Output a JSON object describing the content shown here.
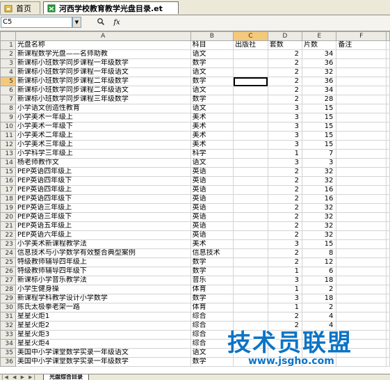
{
  "tabs": {
    "home_label": "首页",
    "file_label": "河西学校教育教学光盘目录.et"
  },
  "formula_bar": {
    "name_box": "C5",
    "search_icon": "magnifier-icon",
    "fx_label": "fx",
    "formula_value": ""
  },
  "columns": [
    "A",
    "B",
    "C",
    "D",
    "E",
    "F"
  ],
  "rows": [
    {
      "n": "1",
      "a": "光盘名称",
      "b": "科目",
      "c": "出版社",
      "d": "套数",
      "e": "片数",
      "f": "备注"
    },
    {
      "n": "2",
      "a": "新课程数学光盘——名师助教",
      "b": "语文",
      "c": "",
      "d": "2",
      "e": "34",
      "f": ""
    },
    {
      "n": "3",
      "a": "新课标小班数学同步课程一年级数学",
      "b": "数学",
      "c": "",
      "d": "2",
      "e": "36",
      "f": ""
    },
    {
      "n": "4",
      "a": "新课标小班数学同步课程一年级语文",
      "b": "语文",
      "c": "",
      "d": "2",
      "e": "32",
      "f": ""
    },
    {
      "n": "5",
      "a": "新课标小班数学同步课程二年级数学",
      "b": "数学",
      "c": "",
      "d": "2",
      "e": "36",
      "f": ""
    },
    {
      "n": "6",
      "a": "新课标小班数学同步课程二年级语文",
      "b": "语文",
      "c": "",
      "d": "2",
      "e": "34",
      "f": ""
    },
    {
      "n": "7",
      "a": "新课标小班数学同步课程三年级数学",
      "b": "数学",
      "c": "",
      "d": "2",
      "e": "28",
      "f": ""
    },
    {
      "n": "8",
      "a": "小学语文创造性教育",
      "b": "语文",
      "c": "",
      "d": "3",
      "e": "15",
      "f": ""
    },
    {
      "n": "9",
      "a": "小学美术一年级上",
      "b": "美术",
      "c": "",
      "d": "3",
      "e": "15",
      "f": ""
    },
    {
      "n": "10",
      "a": "小学美术一年级下",
      "b": "美术",
      "c": "",
      "d": "3",
      "e": "15",
      "f": ""
    },
    {
      "n": "11",
      "a": "小学美术二年级上",
      "b": "美术",
      "c": "",
      "d": "3",
      "e": "15",
      "f": ""
    },
    {
      "n": "12",
      "a": "小学美术三年级上",
      "b": "美术",
      "c": "",
      "d": "3",
      "e": "15",
      "f": ""
    },
    {
      "n": "13",
      "a": "小学科学三年级上",
      "b": "科学",
      "c": "",
      "d": "1",
      "e": "7",
      "f": ""
    },
    {
      "n": "14",
      "a": "杨老师教作文",
      "b": "语文",
      "c": "",
      "d": "3",
      "e": "3",
      "f": ""
    },
    {
      "n": "15",
      "a": "PEP英语四年级上",
      "b": "英语",
      "c": "",
      "d": "2",
      "e": "32",
      "f": ""
    },
    {
      "n": "16",
      "a": "PEP英语四年级下",
      "b": "英语",
      "c": "",
      "d": "2",
      "e": "32",
      "f": ""
    },
    {
      "n": "17",
      "a": "PEP英语四年级上",
      "b": "英语",
      "c": "",
      "d": "2",
      "e": "16",
      "f": ""
    },
    {
      "n": "18",
      "a": "PEP英语四年级下",
      "b": "英语",
      "c": "",
      "d": "2",
      "e": "16",
      "f": ""
    },
    {
      "n": "19",
      "a": "PEP英语三年级上",
      "b": "英语",
      "c": "",
      "d": "2",
      "e": "32",
      "f": ""
    },
    {
      "n": "20",
      "a": "PEP英语三年级下",
      "b": "英语",
      "c": "",
      "d": "2",
      "e": "32",
      "f": ""
    },
    {
      "n": "21",
      "a": "PEP英语五年级上",
      "b": "英语",
      "c": "",
      "d": "2",
      "e": "32",
      "f": ""
    },
    {
      "n": "22",
      "a": "PEP英语六年级上",
      "b": "英语",
      "c": "",
      "d": "2",
      "e": "32",
      "f": ""
    },
    {
      "n": "23",
      "a": "小学美术新课程教学法",
      "b": "美术",
      "c": "",
      "d": "3",
      "e": "15",
      "f": ""
    },
    {
      "n": "24",
      "a": "信息技术与小学数学有效整合典型案例",
      "b": "信息技术",
      "c": "",
      "d": "2",
      "e": "8",
      "f": ""
    },
    {
      "n": "25",
      "a": "特级教师辅导四年级上",
      "b": "数学",
      "c": "",
      "d": "2",
      "e": "12",
      "f": ""
    },
    {
      "n": "26",
      "a": "特级教师辅导四年级下",
      "b": "数学",
      "c": "",
      "d": "1",
      "e": "6",
      "f": ""
    },
    {
      "n": "27",
      "a": "新课标小学音乐教学法",
      "b": "音乐",
      "c": "",
      "d": "3",
      "e": "18",
      "f": ""
    },
    {
      "n": "28",
      "a": "小学生健身操",
      "b": "体育",
      "c": "",
      "d": "1",
      "e": "2",
      "f": ""
    },
    {
      "n": "29",
      "a": "新课程学科教学设计小学数学",
      "b": "数学",
      "c": "",
      "d": "3",
      "e": "18",
      "f": ""
    },
    {
      "n": "30",
      "a": "陈氏太极拳老架一路",
      "b": "体育",
      "c": "",
      "d": "1",
      "e": "2",
      "f": ""
    },
    {
      "n": "31",
      "a": "星星火炬1",
      "b": "综合",
      "c": "",
      "d": "2",
      "e": "4",
      "f": ""
    },
    {
      "n": "32",
      "a": "星星火炬2",
      "b": "综合",
      "c": "",
      "d": "2",
      "e": "4",
      "f": ""
    },
    {
      "n": "33",
      "a": "星星火炬3",
      "b": "综合",
      "c": "",
      "d": "",
      "e": "",
      "f": ""
    },
    {
      "n": "34",
      "a": "星星火炬4",
      "b": "综合",
      "c": "",
      "d": "",
      "e": "",
      "f": ""
    },
    {
      "n": "35",
      "a": "美国中小学课堂数学实录一年级语文",
      "b": "语文",
      "c": "",
      "d": "",
      "e": "",
      "f": ""
    },
    {
      "n": "36",
      "a": "美国中小学课堂数学实录一年级数学",
      "b": "数学",
      "c": "",
      "d": "",
      "e": "",
      "f": ""
    }
  ],
  "selection": {
    "row": "5",
    "column": "C"
  },
  "sheet": {
    "tab_label": "光盘综合目录"
  },
  "watermark": {
    "line1": "技术员联盟",
    "line2": "www.jsgho.com"
  },
  "colors": {
    "selection_header": "#f5c97a",
    "header_bg": "#ecebe4",
    "watermark": "#0b74c6"
  }
}
